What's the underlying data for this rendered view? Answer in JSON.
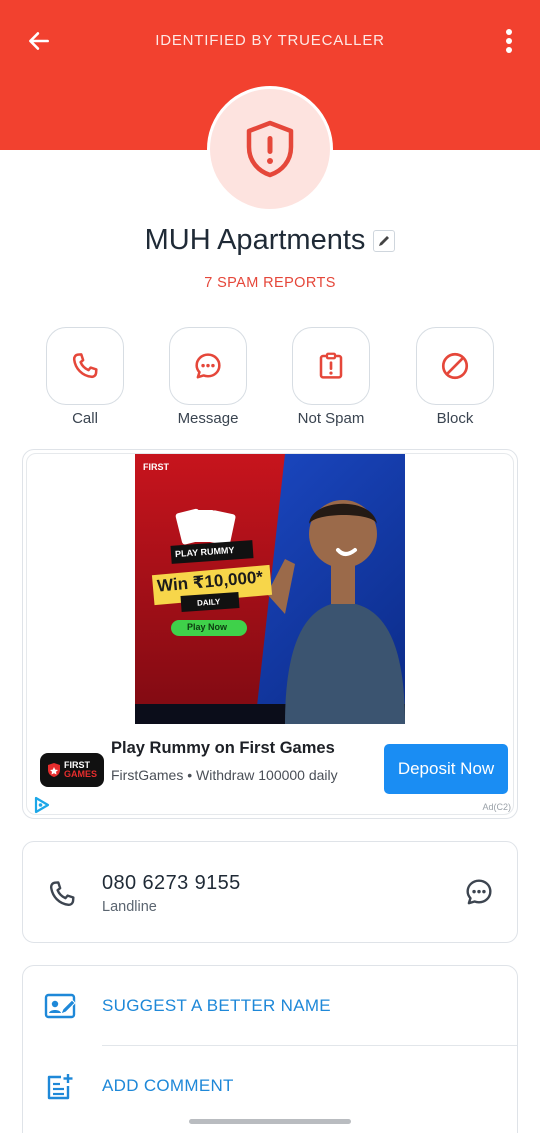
{
  "header": {
    "title": "IDENTIFIED BY TRUECALLER",
    "back_icon": "arrow-left-icon",
    "menu_icon": "more-vertical-icon",
    "color": "#f2412f"
  },
  "contact": {
    "name": "MUH Apartments",
    "spam_reports": "7 SPAM REPORTS",
    "avatar_icon": "shield-alert-icon"
  },
  "actions": [
    {
      "label": "Call",
      "icon": "phone-icon"
    },
    {
      "label": "Message",
      "icon": "chat-bubble-icon"
    },
    {
      "label": "Not Spam",
      "icon": "clipboard-alert-icon"
    },
    {
      "label": "Block",
      "icon": "block-icon"
    }
  ],
  "ad": {
    "title": "Play Rummy on First Games",
    "subtitle": "FirstGames • Withdraw 100000 daily",
    "cta": "Deposit Now",
    "tag": "Ad(C2)",
    "logo_line1": "FIRST",
    "logo_line2": "GAMES",
    "banner_brand": "FIRST",
    "banner_game": "PLAY RUMMY",
    "banner_win": "Win ₹10,000*",
    "banner_daily": "DAILY",
    "banner_play": "Play Now",
    "cta_color": "#1a8df3"
  },
  "phone": {
    "number": "080 6273 9155",
    "type": "Landline"
  },
  "options": [
    {
      "label": "SUGGEST A BETTER NAME",
      "icon": "edit-contact-icon"
    },
    {
      "label": "ADD COMMENT",
      "icon": "add-note-icon"
    }
  ]
}
